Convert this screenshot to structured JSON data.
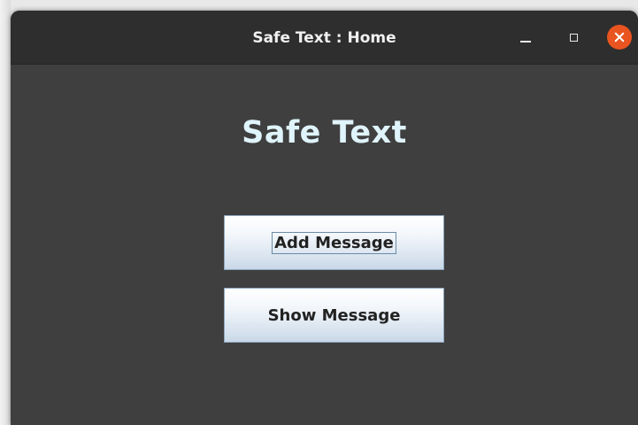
{
  "window": {
    "title": "Safe Text : Home",
    "controls": {
      "minimize_icon": "minimize-icon",
      "maximize_icon": "maximize-icon",
      "close_icon": "close-icon",
      "close_color": "#e95420"
    }
  },
  "main": {
    "heading": "Safe Text",
    "heading_color": "#dff4fb",
    "buttons": [
      {
        "label": "Add Message",
        "focused": true
      },
      {
        "label": "Show Message",
        "focused": false
      }
    ]
  }
}
